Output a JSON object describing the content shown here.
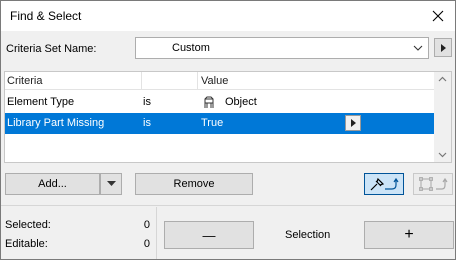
{
  "window": {
    "title": "Find & Select"
  },
  "criteria_set": {
    "label": "Criteria Set Name:",
    "value": "Custom"
  },
  "table": {
    "headers": [
      "Criteria",
      "",
      "Value"
    ],
    "rows": [
      {
        "criteria": "Element Type",
        "operator": "is",
        "value": "Object",
        "icon": "object-icon",
        "selected": false
      },
      {
        "criteria": "Library Part Missing",
        "operator": "is",
        "value": "True",
        "selected": true
      }
    ]
  },
  "buttons": {
    "add": "Add...",
    "remove": "Remove"
  },
  "stats": {
    "selected_label": "Selected:",
    "selected_value": "0",
    "editable_label": "Editable:",
    "editable_value": "0"
  },
  "selection": {
    "label": "Selection",
    "minus": "—",
    "plus": "+"
  },
  "colors": {
    "accent": "#0078d7",
    "background": "#f0f0f0"
  }
}
